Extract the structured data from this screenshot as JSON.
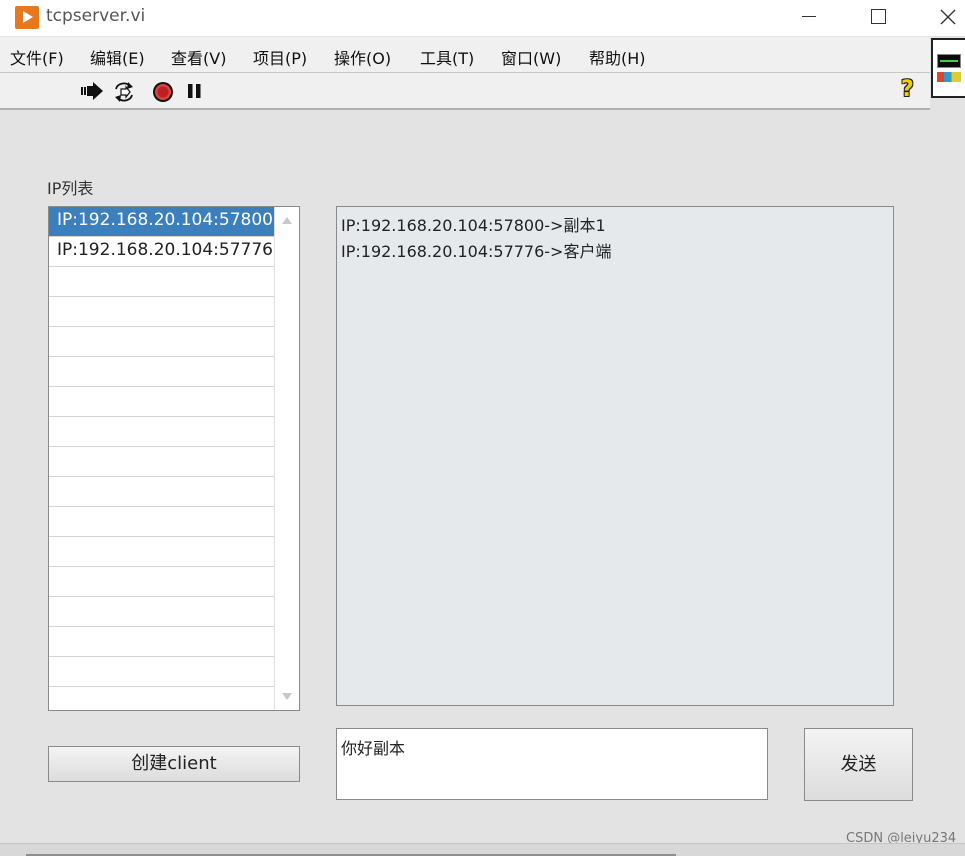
{
  "window": {
    "title": "tcpserver.vi"
  },
  "menu": [
    "文件(F)",
    "编辑(E)",
    "查看(V)",
    "项目(P)",
    "操作(O)",
    "工具(T)",
    "窗口(W)",
    "帮助(H)"
  ],
  "toolbar": {
    "icons": [
      "run-arrow-icon",
      "run-continuously-icon",
      "abort-stop-icon",
      "pause-icon"
    ],
    "help_glyph": "?"
  },
  "ip_list": {
    "label": "IP列表",
    "items": [
      "IP:192.168.20.104:57800",
      "IP:192.168.20.104:57776",
      "",
      "",
      "",
      "",
      "",
      "",
      "",
      "",
      "",
      "",
      "",
      "",
      "",
      "",
      ""
    ],
    "selected_index": 0
  },
  "display": {
    "lines": [
      "IP:192.168.20.104:57800->副本1",
      "IP:192.168.20.104:57776->客户端"
    ]
  },
  "message_input": {
    "value": "你好副本"
  },
  "buttons": {
    "create": "创建client",
    "send": "发送"
  },
  "watermark": "CSDN @leiyu234",
  "colors": {
    "selection": "#3c7fbd",
    "app_icon": "#e8781e",
    "panel_bg": "#e3e3e3",
    "display_bg": "#e6e9ec"
  }
}
